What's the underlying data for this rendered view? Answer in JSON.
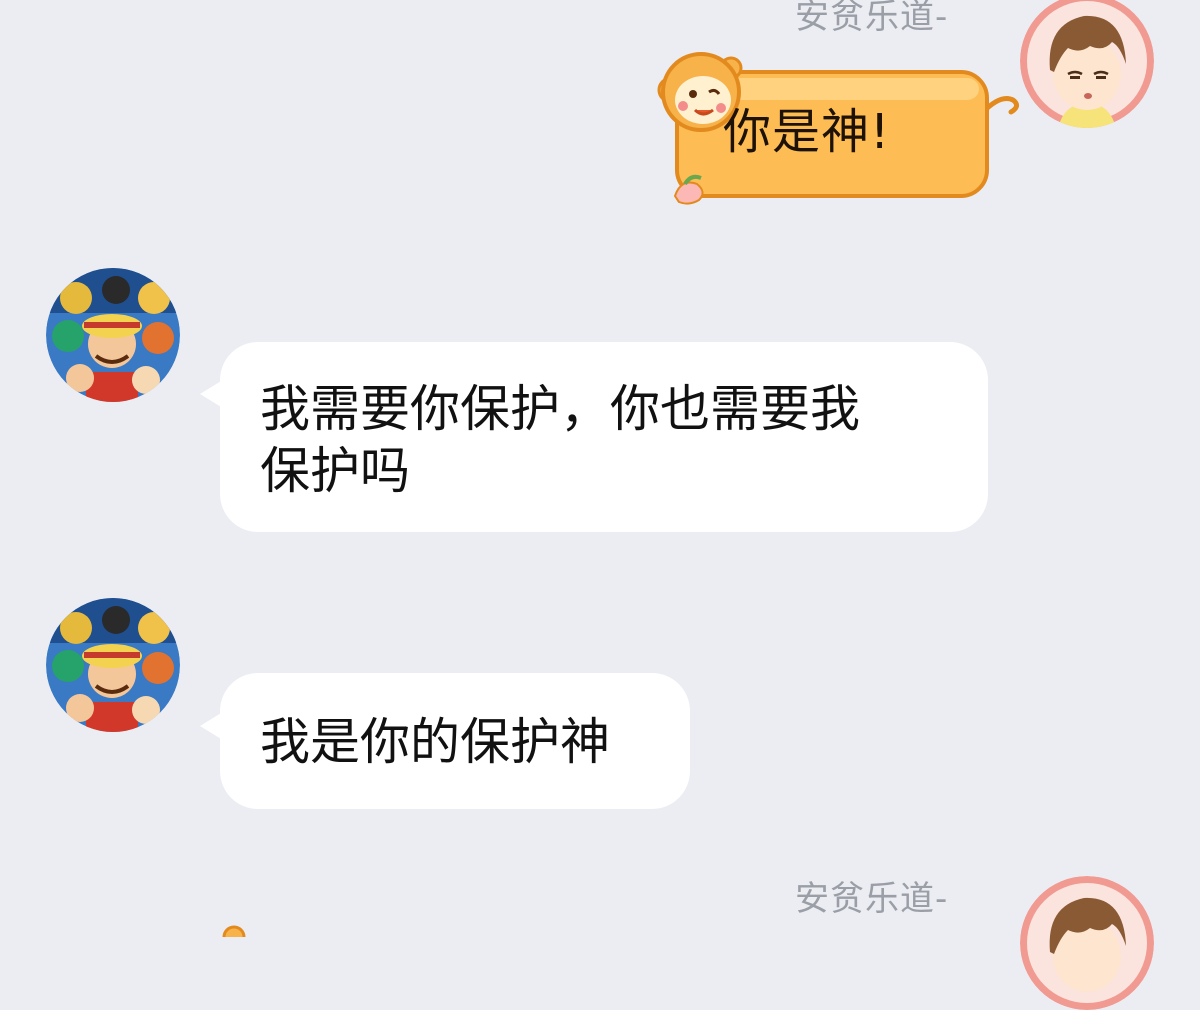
{
  "chat": {
    "messages": [
      {
        "sender": "安贫乐道-",
        "text": "你是神!",
        "side": "right",
        "bubble_style": "monkey-sticker"
      },
      {
        "text": "我需要你保护，你也需要我保护吗",
        "line1": "我需要你保护，你也需要我",
        "line2": "保护吗",
        "side": "left"
      },
      {
        "text": "我是你的保护神",
        "side": "left"
      },
      {
        "sender": "安贫乐道-",
        "side": "right"
      }
    ]
  },
  "colors": {
    "background": "#ebedf2",
    "bubble_incoming": "#ffffff",
    "monkey_bubble_fill": "#fdbd54",
    "monkey_bubble_border": "#e28a1e",
    "sender_name": "#9a9ea6"
  },
  "icons": {
    "right_avatar": "cartoon-boy-avatar-icon",
    "left_avatar": "one-piece-group-avatar-icon",
    "monkey": "monkey-sticker-icon",
    "peach": "peach-icon"
  }
}
